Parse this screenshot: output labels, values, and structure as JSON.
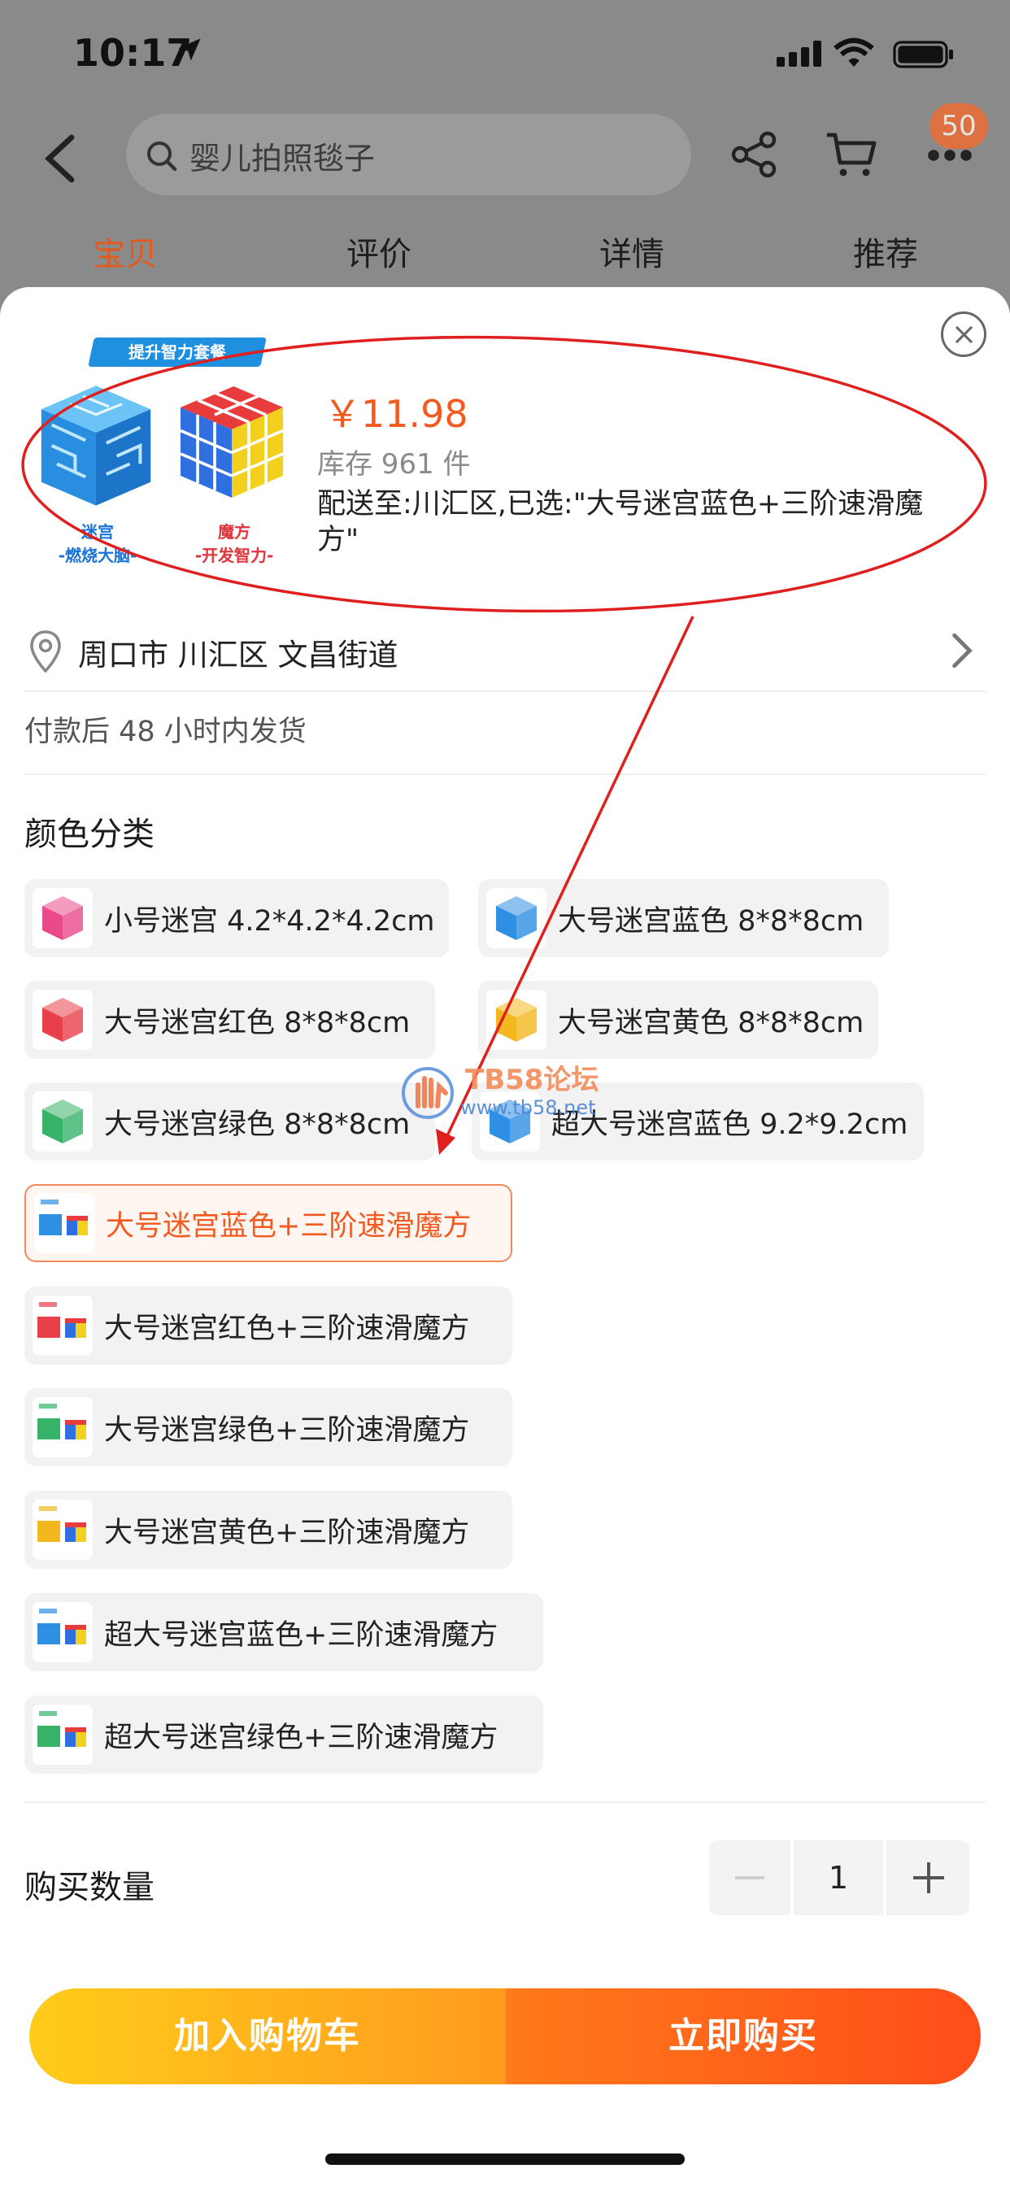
{
  "status_bar": {
    "time": "10:17"
  },
  "top_bar": {
    "search_placeholder": "婴儿拍照毯子",
    "cart_badge": "50"
  },
  "tabs": [
    {
      "label": "宝贝",
      "active": true
    },
    {
      "label": "评价",
      "active": false
    },
    {
      "label": "详情",
      "active": false
    },
    {
      "label": "推荐",
      "active": false
    }
  ],
  "sku_sheet": {
    "package_tag": "提升智力套餐",
    "image_captions": {
      "maze_title": "迷宫",
      "maze_sub": "-燃烧大脑-",
      "cube_title": "魔方",
      "cube_sub": "-开发智力-"
    },
    "price": "￥11.98",
    "stock": "库存 961 件",
    "shipping": "配送至:川汇区,已选:\"大号迷宫蓝色+三阶速滑魔方\"",
    "address": "周口市 川汇区 文昌街道",
    "dispatch_note": "付款后 48 小时内发货",
    "color_section_title": "颜色分类",
    "options": [
      {
        "label": "小号迷宫 4.2*4.2*4.2cm",
        "thumb_color": "#e94a8a",
        "selected": false
      },
      {
        "label": "大号迷宫蓝色 8*8*8cm",
        "thumb_color": "#2f8fe3",
        "selected": false
      },
      {
        "label": "大号迷宫红色 8*8*8cm",
        "thumb_color": "#e8404b",
        "selected": false
      },
      {
        "label": "大号迷宫黄色 8*8*8cm",
        "thumb_color": "#f2b81e",
        "selected": false
      },
      {
        "label": "大号迷宫绿色 8*8*8cm",
        "thumb_color": "#38b36a",
        "selected": false
      },
      {
        "label": "超大号迷宫蓝色 9.2*9.2cm",
        "thumb_color": "#2f8fe3",
        "selected": false
      },
      {
        "label": "大号迷宫蓝色+三阶速滑魔方",
        "thumb_color": "#2f8fe3",
        "selected": true
      },
      {
        "label": "大号迷宫红色+三阶速滑魔方",
        "thumb_color": "#e8404b",
        "selected": false
      },
      {
        "label": "大号迷宫绿色+三阶速滑魔方",
        "thumb_color": "#38b36a",
        "selected": false
      },
      {
        "label": "大号迷宫黄色+三阶速滑魔方",
        "thumb_color": "#f2b81e",
        "selected": false
      },
      {
        "label": "超大号迷宫蓝色+三阶速滑魔方",
        "thumb_color": "#2f8fe3",
        "selected": false
      },
      {
        "label": "超大号迷宫绿色+三阶速滑魔方",
        "thumb_color": "#38b36a",
        "selected": false
      }
    ],
    "quantity_label": "购买数量",
    "quantity_value": "1",
    "add_to_cart_label": "加入购物车",
    "buy_now_label": "立即购买"
  },
  "watermark": {
    "text": "TB58论坛",
    "url": "www.tb58.net"
  },
  "colors": {
    "accent": "#f25a1f",
    "annotation": "#e01f1f"
  }
}
